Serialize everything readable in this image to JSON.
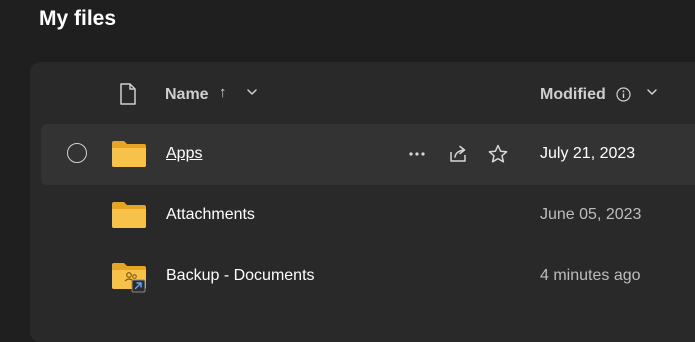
{
  "page": {
    "title": "My files"
  },
  "header": {
    "name_label": "Name",
    "sort_indicator": "↑",
    "modified_label": "Modified",
    "icons": [
      "file-type-icon",
      "sort-arrow-up-icon",
      "chevron-down-icon",
      "info-icon"
    ]
  },
  "rows": [
    {
      "name": "Apps",
      "modified": "July 21, 2023",
      "selected_hover": true,
      "icon": "folder-icon",
      "actions": [
        "more-options-icon",
        "share-icon",
        "star-icon"
      ]
    },
    {
      "name": "Attachments",
      "modified": "June 05, 2023",
      "icon": "folder-icon"
    },
    {
      "name": "Backup - Documents",
      "modified": "4 minutes ago",
      "icon": "shared-folder-shortcut-icon"
    }
  ],
  "colors": {
    "background": "#1f1f1f",
    "panel": "#292929",
    "row_hover": "#333333",
    "folder_yellow": "#f6c24a",
    "folder_back": "#e4a623",
    "text_primary": "#ffffff",
    "text_muted": "#bdbdbd"
  }
}
